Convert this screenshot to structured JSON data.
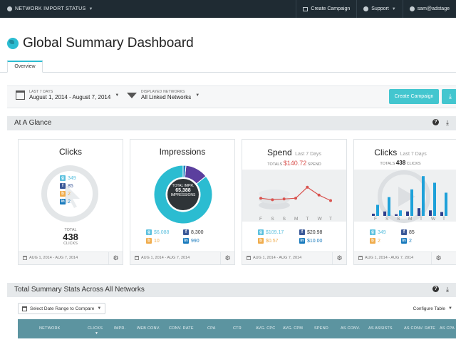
{
  "topbar": {
    "status": "NETWORK IMPORT STATUS",
    "create_campaign": "Create Campaign",
    "support": "Support",
    "user": "sam@adstage"
  },
  "page": {
    "title": "Global Summary Dashboard",
    "tab_overview": "Overview"
  },
  "filters": {
    "date_small": "LAST 7 DAYS",
    "date_value": "August 1, 2014 - August 7, 2014",
    "networks_small": "DISPLAYED NETWORKS",
    "networks_value": "All Linked Networks",
    "create_campaign": "Create Campaign"
  },
  "at_a_glance": {
    "title": "At A Glance",
    "footer_date": "AUG 1, 2014 - AUG 7, 2014",
    "clicks_card": {
      "title": "Clicks",
      "legend": [
        {
          "icon": "google-icon",
          "value": "349"
        },
        {
          "icon": "facebook-icon",
          "value": "85"
        },
        {
          "icon": "bing-icon",
          "value": "2"
        },
        {
          "icon": "linkedin-icon",
          "value": "2"
        }
      ],
      "total_label": "TOTAL",
      "total_value": "438",
      "total_unit": "CLICKS"
    },
    "impressions_card": {
      "title": "Impressions",
      "center_label": "TOTAL IMPR.",
      "center_value": "65,388",
      "center_unit": "IMPRESSIONS",
      "legend": [
        {
          "icon": "google-icon",
          "value": "$6,088"
        },
        {
          "icon": "facebook-icon",
          "value": "8,300"
        },
        {
          "icon": "bing-icon",
          "value": "10"
        },
        {
          "icon": "linkedin-icon",
          "value": "990"
        }
      ]
    },
    "spend_card": {
      "title": "Spend",
      "subtitle": "Last 7 Days",
      "total_label": "TOTALS",
      "total_value": "$140.72",
      "total_unit": "SPEND",
      "days": [
        "F",
        "S",
        "S",
        "M",
        "T",
        "W",
        "T"
      ],
      "legend": [
        {
          "icon": "google-icon",
          "value": "$109.17"
        },
        {
          "icon": "facebook-icon",
          "value": "$20.98"
        },
        {
          "icon": "bing-icon",
          "value": "$0.57"
        },
        {
          "icon": "linkedin-icon",
          "value": "$10.00"
        }
      ]
    },
    "clicks7_card": {
      "title": "Clicks",
      "subtitle": "Last 7 Days",
      "total_label": "TOTALS",
      "total_value": "438",
      "total_unit": "CLICKS",
      "days": [
        "F",
        "S",
        "S",
        "M",
        "T",
        "W",
        "T"
      ],
      "legend": [
        {
          "icon": "google-icon",
          "value": "349"
        },
        {
          "icon": "facebook-icon",
          "value": "85"
        },
        {
          "icon": "bing-icon",
          "value": "2"
        },
        {
          "icon": "linkedin-icon",
          "value": "2"
        }
      ]
    }
  },
  "summary": {
    "title": "Total Summary Stats Across All Networks",
    "select_range": "Select Date Range to Compare",
    "configure": "Configure Table",
    "columns": [
      "NETWORK",
      "CLICKS",
      "IMPR.",
      "WEB CONV.",
      "CONV. RATE",
      "CPA",
      "CTR",
      "AVG. CPC",
      "AVG. CPM",
      "SPEND",
      "AS CONV.",
      "AS ASSISTS",
      "AS CONV. RATE",
      "AS CPA"
    ]
  },
  "colors": {
    "teal": "#43c6cf",
    "cyan": "#2bbcd1",
    "purple": "#5b3f9e",
    "spend_red": "#d9534f",
    "bar_blue": "#1ea1d9",
    "bar_navy": "#2e3f8c"
  },
  "chart_data": [
    {
      "type": "pie",
      "title": "Impressions",
      "labels": [
        "Google",
        "Facebook",
        "Bing",
        "LinkedIn"
      ],
      "values": [
        56088,
        8300,
        10,
        990
      ]
    },
    {
      "type": "line",
      "title": "Spend",
      "categories": [
        "F",
        "S",
        "S",
        "M",
        "T",
        "W",
        "T"
      ],
      "values": [
        18,
        16,
        17,
        18,
        32,
        22,
        15
      ]
    },
    {
      "type": "bar",
      "title": "Clicks",
      "categories": [
        "F",
        "S",
        "S",
        "M",
        "T",
        "W",
        "T"
      ],
      "series": [
        {
          "values": [
            20,
            34,
            10,
            48,
            72,
            60,
            42
          ]
        },
        {
          "values": [
            4,
            8,
            3,
            8,
            14,
            10,
            7
          ]
        }
      ]
    }
  ]
}
